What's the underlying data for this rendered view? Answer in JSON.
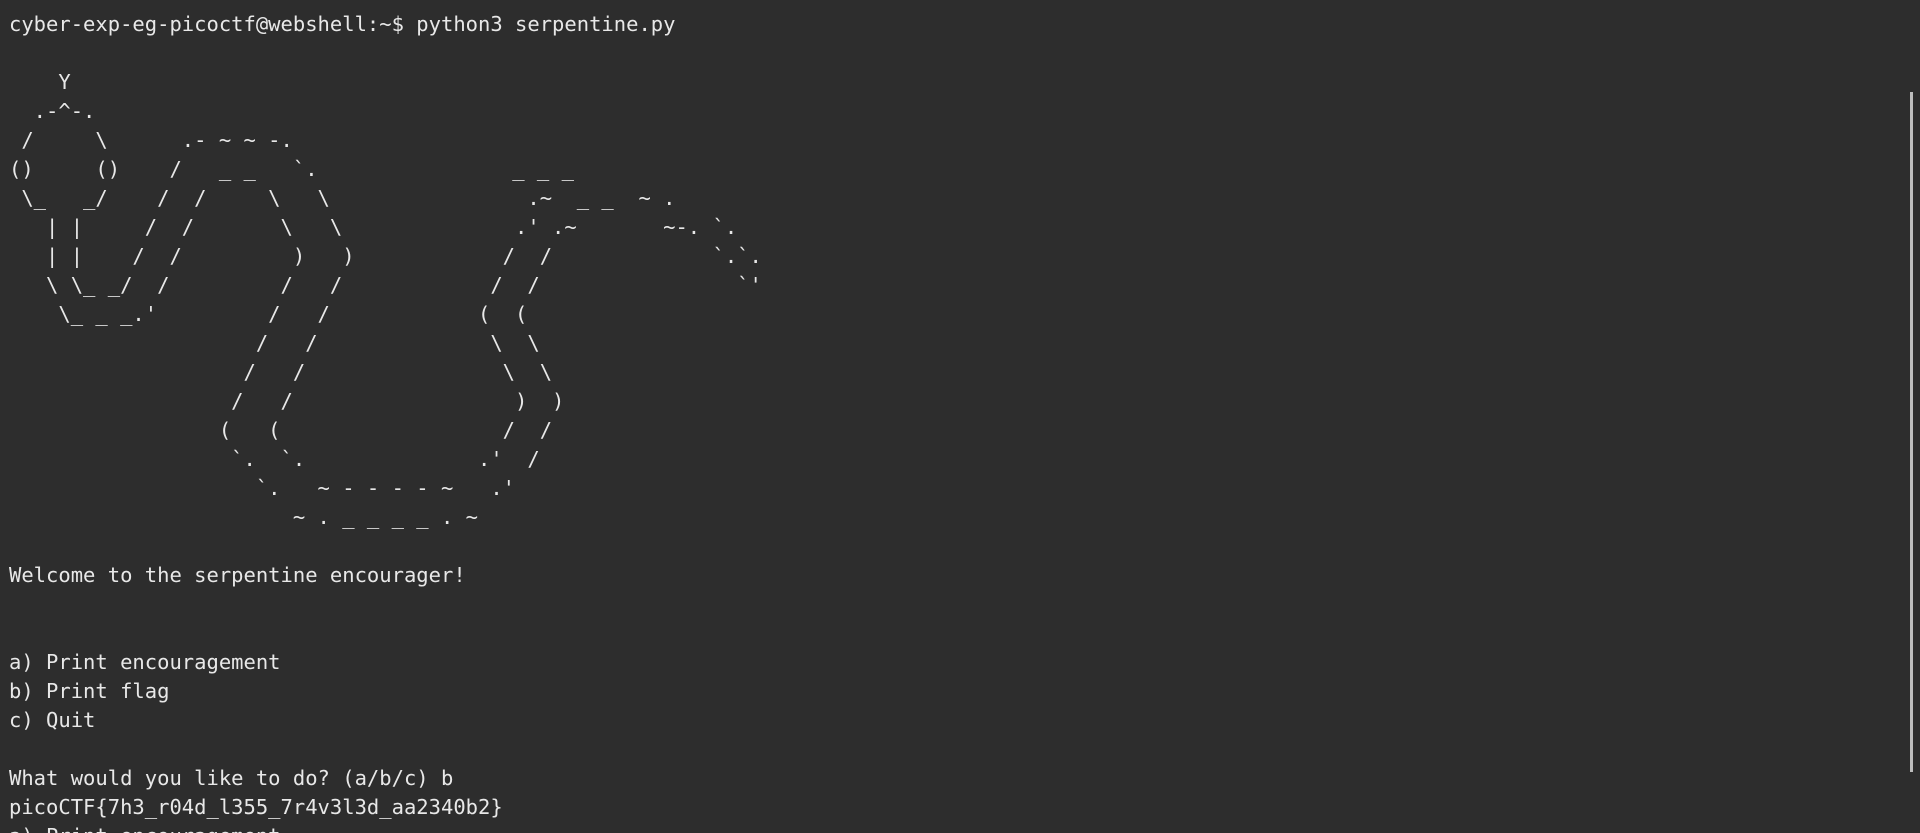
{
  "terminal": {
    "lines": [
      "cyber-exp-eg-picoctf@webshell:~$ python3 serpentine.py",
      "",
      "    Y",
      "  .-^-.",
      " /     \\      .- ~ ~ -.",
      "()     ()    /   _ _   `.",
      " \\_   _/    /  /     \\   \\                .~  _ _  ~ .",
      "   | |     /  /       \\   \\              .' .~       ~-. `.",
      "   | |    /  /         )   )            /  /             `.`.",
      "   \\ \\_ _/  /         /   /            /  /                `'",
      "    \\_ _ _.'         /   /            (  (",
      "                    /   /              \\  \\",
      "                   /   /                \\  \\",
      "                  /   /                  )  )",
      "                 (   (                  /  /",
      "                  `.  `.              .'  /",
      "                    `.   ~ - - - - ~   .'",
      "                       ~ . _ _ _ _ . ~",
      "",
      "Welcome to the serpentine encourager!",
      "",
      "",
      "a) Print encouragement",
      "b) Print flag",
      "c) Quit",
      "",
      "What would you like to do? (a/b/c) b",
      "picoCTF{7h3_r04d_l355_7r4v3l3d_aa2340b2}",
      "a) Print encouragement"
    ],
    "ascii_extra": "  _ _ _"
  }
}
